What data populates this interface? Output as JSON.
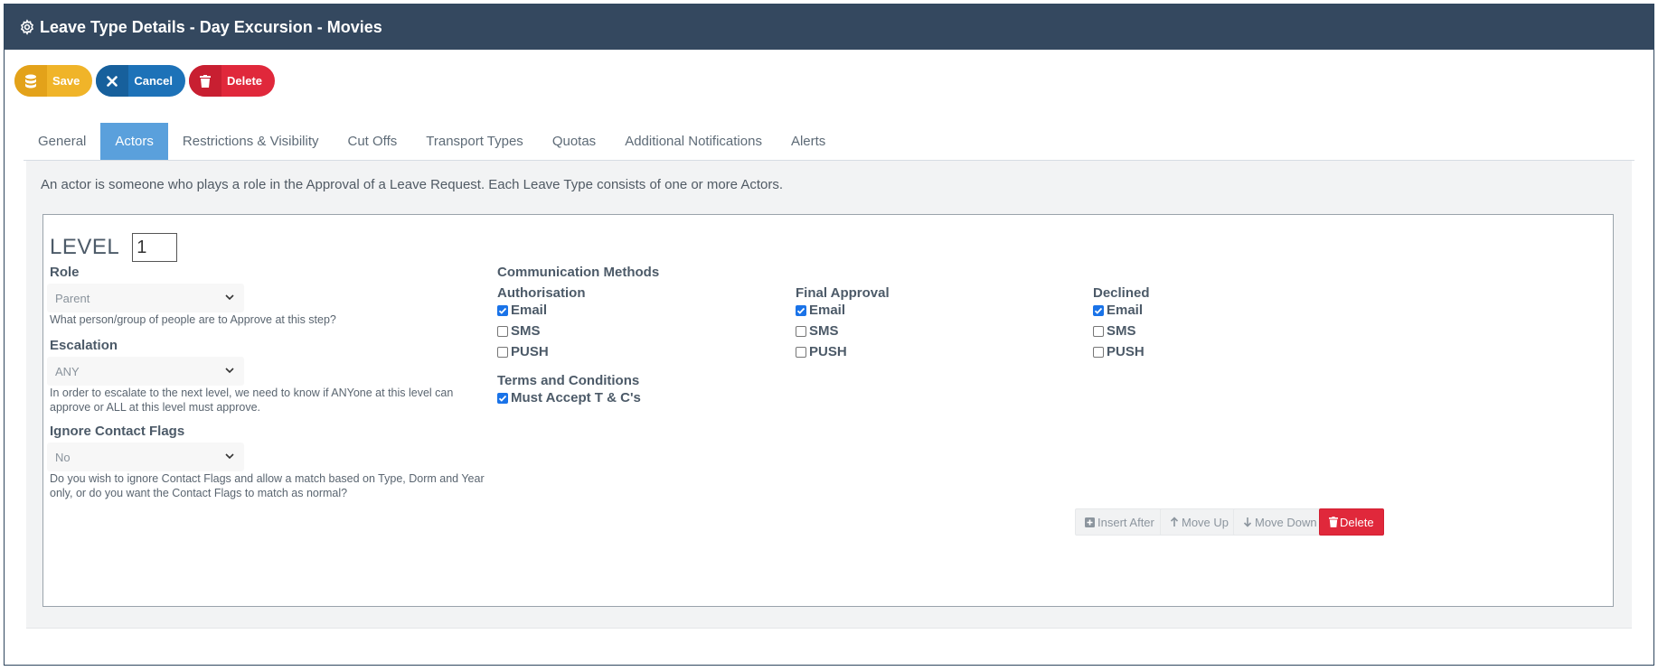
{
  "header": {
    "title": "Leave Type Details - Day Excursion - Movies",
    "icon": "gear-icon"
  },
  "actions": {
    "save": "Save",
    "cancel": "Cancel",
    "delete": "Delete"
  },
  "tabs": [
    {
      "label": "General"
    },
    {
      "label": "Actors",
      "active": true
    },
    {
      "label": "Restrictions & Visibility"
    },
    {
      "label": "Cut Offs"
    },
    {
      "label": "Transport Types"
    },
    {
      "label": "Quotas"
    },
    {
      "label": "Additional Notifications"
    },
    {
      "label": "Alerts"
    }
  ],
  "intro": "An actor is someone who plays a role in the Approval of a Leave Request. Each Leave Type consists of one or more Actors.",
  "actor": {
    "level_label": "LEVEL",
    "level_value": "1",
    "role": {
      "label": "Role",
      "value": "Parent",
      "help": "What person/group of people are to Approve at this step?"
    },
    "escalation": {
      "label": "Escalation",
      "value": "ANY",
      "help": "In order to escalate to the next level, we need to know if ANYone at this level can approve or ALL at this level must approve."
    },
    "ignore_flags": {
      "label": "Ignore Contact Flags",
      "value": "No",
      "help": "Do you wish to ignore Contact Flags and allow a match based on Type, Dorm and Year only, or do you want the Contact Flags to match as normal?"
    },
    "comm": {
      "title": "Communication Methods",
      "authorisation": {
        "title": "Authorisation",
        "email": "Email",
        "sms": "SMS",
        "push": "PUSH"
      },
      "final_approval": {
        "title": "Final Approval",
        "email": "Email",
        "sms": "SMS",
        "push": "PUSH"
      },
      "declined": {
        "title": "Declined",
        "email": "Email",
        "sms": "SMS",
        "push": "PUSH"
      }
    },
    "terms": {
      "title": "Terms and Conditions",
      "accept": "Must Accept T & C's"
    },
    "buttons": {
      "insert_after": "Insert After",
      "move_up": "Move Up",
      "move_down": "Move Down",
      "delete": "Delete"
    }
  },
  "colors": {
    "header_bg": "#34485f",
    "active_tab": "#5aa0dc",
    "save": "#f0b429",
    "cancel": "#1d72b8",
    "delete": "#e0283b"
  }
}
